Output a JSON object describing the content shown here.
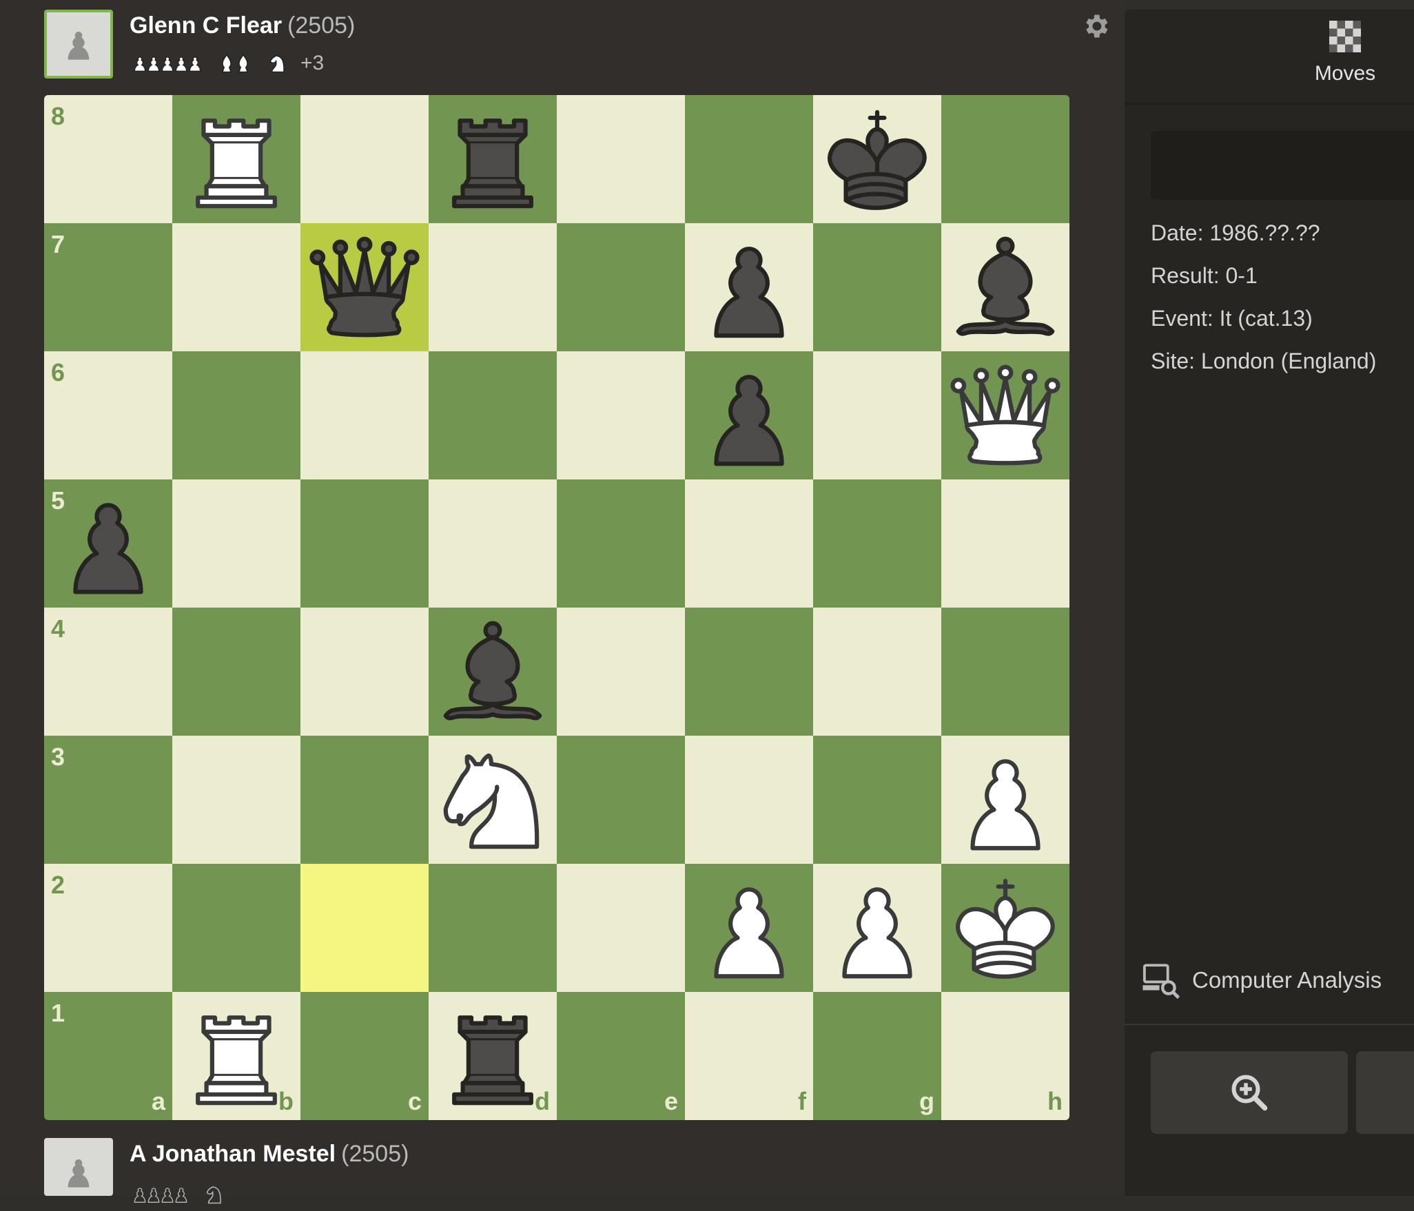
{
  "players": {
    "top": {
      "name": "Glenn C Flear",
      "rating": "(2505)",
      "material_advantage": "+3"
    },
    "bottom": {
      "name": "A Jonathan Mestel",
      "rating": "(2505)"
    }
  },
  "board": {
    "ranks": [
      "8",
      "7",
      "6",
      "5",
      "4",
      "3",
      "2",
      "1"
    ],
    "files": [
      "a",
      "b",
      "c",
      "d",
      "e",
      "f",
      "g",
      "h"
    ],
    "pieces": [
      {
        "square": "b8",
        "piece": "wR"
      },
      {
        "square": "d8",
        "piece": "bR"
      },
      {
        "square": "g8",
        "piece": "bK"
      },
      {
        "square": "c7",
        "piece": "bQ"
      },
      {
        "square": "f7",
        "piece": "bP"
      },
      {
        "square": "h7",
        "piece": "bB"
      },
      {
        "square": "f6",
        "piece": "bP"
      },
      {
        "square": "h6",
        "piece": "wQ"
      },
      {
        "square": "a5",
        "piece": "bP"
      },
      {
        "square": "d4",
        "piece": "bB"
      },
      {
        "square": "d3",
        "piece": "wN"
      },
      {
        "square": "h3",
        "piece": "wP"
      },
      {
        "square": "f2",
        "piece": "wP"
      },
      {
        "square": "g2",
        "piece": "wP"
      },
      {
        "square": "h2",
        "piece": "wK"
      },
      {
        "square": "b1",
        "piece": "wR"
      },
      {
        "square": "d1",
        "piece": "bR"
      }
    ],
    "highlights": [
      "c7",
      "c2"
    ],
    "colors": {
      "light": "#ebecd0",
      "dark": "#739552",
      "highlight_light": "#f5f682",
      "highlight_dark": "#b9ca43"
    }
  },
  "panel": {
    "tab_moves_label": "Moves",
    "info": {
      "date": "Date: 1986.??.??",
      "result": "Result: 0-1",
      "event": "Event: It (cat.13)",
      "site": "Site: London (England)"
    },
    "computer_analysis_label": "Computer Analysis"
  },
  "icons": {
    "settings": "gear-icon",
    "moves_tab": "checkerboard-icon",
    "computer_analysis": "computer-magnifier-icon",
    "zoom": "magnifier-plus-icon"
  }
}
